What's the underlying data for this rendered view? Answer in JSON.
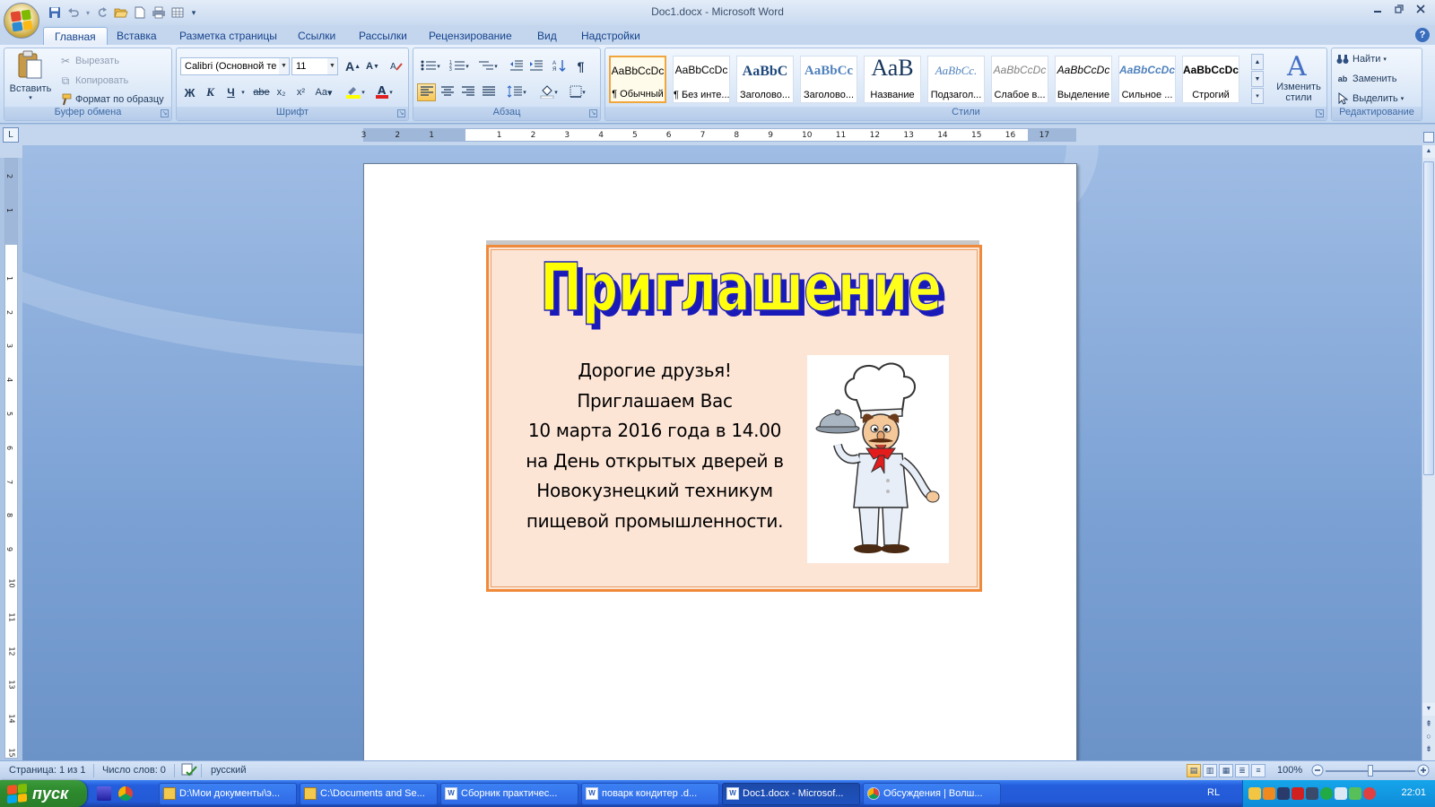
{
  "window": {
    "title": "Doc1.docx - Microsoft Word"
  },
  "quick_access": {
    "icons": [
      "save-icon",
      "undo-icon",
      "redo-icon",
      "open-folder-icon",
      "new-document-icon",
      "print-preview-icon",
      "insert-table-icon",
      "customize-icon"
    ]
  },
  "tabs": [
    {
      "label": "Главная",
      "active": true
    },
    {
      "label": "Вставка"
    },
    {
      "label": "Разметка страницы"
    },
    {
      "label": "Ссылки"
    },
    {
      "label": "Рассылки"
    },
    {
      "label": "Рецензирование"
    },
    {
      "label": "Вид"
    },
    {
      "label": "Надстройки"
    }
  ],
  "clipboard": {
    "paste": "Вставить",
    "cut": "Вырезать",
    "copy": "Копировать",
    "format_painter": "Формат по образцу",
    "label": "Буфер обмена"
  },
  "font": {
    "name": "Calibri (Основной те",
    "size": "11",
    "label": "Шрифт",
    "bold": "Ж",
    "italic": "К",
    "underline": "Ч",
    "strike": "abe",
    "subscript": "x₂",
    "superscript": "x²",
    "case": "Aa",
    "grow": "A",
    "shrink": "A"
  },
  "paragraph": {
    "label": "Абзац"
  },
  "styles": {
    "label": "Стили",
    "items": [
      {
        "sample": "AaBbCcDc",
        "name": "¶ Обычный",
        "selected": true
      },
      {
        "sample": "AaBbCcDc",
        "name": "¶ Без инте..."
      },
      {
        "sample": "AaBbC",
        "name": "Заголово..."
      },
      {
        "sample": "AaBbCc",
        "name": "Заголово..."
      },
      {
        "sample": "АаВ",
        "name": "Название"
      },
      {
        "sample": "AaBbCc.",
        "name": "Подзагол..."
      },
      {
        "sample": "AaBbCcDc",
        "name": "Слабое в..."
      },
      {
        "sample": "AaBbCcDc",
        "name": "Выделение"
      },
      {
        "sample": "AaBbCcDc",
        "name": "Сильное ..."
      },
      {
        "sample": "AaBbCcDc",
        "name": "Строгий"
      }
    ],
    "change_styles": "Изменить стили"
  },
  "editing": {
    "label": "Редактирование",
    "find": "Найти",
    "replace": "Заменить",
    "select": "Выделить"
  },
  "ruler": {
    "h_ticks": [
      "3",
      "2",
      "1",
      "1",
      "2",
      "3",
      "4",
      "5",
      "6",
      "7",
      "8",
      "9",
      "10",
      "11",
      "12",
      "13",
      "14",
      "15",
      "16",
      "17"
    ],
    "v_ticks": [
      "2",
      "1",
      "1",
      "2",
      "3",
      "4",
      "5",
      "6",
      "7",
      "8",
      "9",
      "10",
      "11",
      "12",
      "13",
      "14",
      "15"
    ]
  },
  "document": {
    "invitation_title": "Приглашение",
    "lines": [
      "Дорогие друзья!",
      "Приглашаем Вас",
      "10 марта 2016 года в 14.00",
      "на День открытых дверей в",
      "Новокузнецкий техникум",
      "пищевой промышленности."
    ]
  },
  "status": {
    "page": "Страница: 1 из 1",
    "words": "Число слов: 0",
    "language": "русский",
    "zoom": "100%",
    "zoom_level": 1.0
  },
  "taskbar": {
    "start": "пуск",
    "tasks": [
      {
        "label": "D:\\Мои документы\\э...",
        "icon": "folder-icon"
      },
      {
        "label": "C:\\Documents and Se...",
        "icon": "folder-icon"
      },
      {
        "label": "Сборник практичес...",
        "icon": "word-icon"
      },
      {
        "label": "поварк кондитер .d...",
        "icon": "word-icon"
      },
      {
        "label": "Doc1.docx - Microsof...",
        "icon": "word-icon",
        "active": true
      },
      {
        "label": "Обсуждения | Волш...",
        "icon": "chrome-icon"
      }
    ],
    "lang": "RL",
    "clock": "22:01"
  },
  "colors": {
    "accent": "#f08a3b",
    "card_bg": "#fde5d6",
    "title_fill": "#ffff00",
    "title_shadow": "#1a1ab8"
  }
}
